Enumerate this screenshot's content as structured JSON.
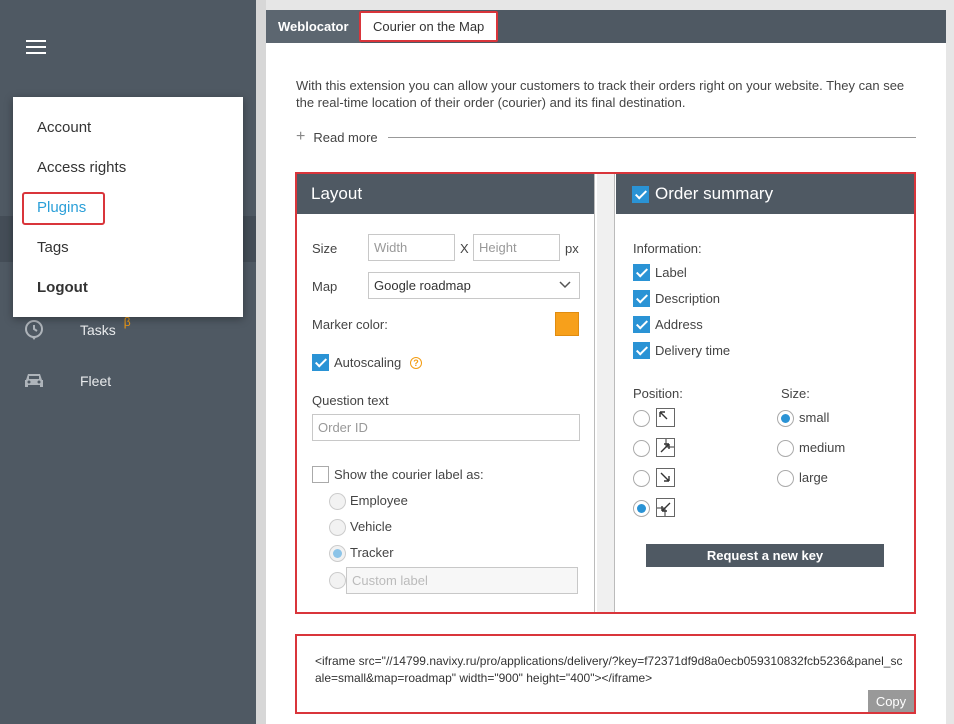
{
  "sidebar": {
    "menu_icon": "hamburger-icon",
    "items": [
      {
        "label": "Tasks",
        "icon": "location-pin-icon",
        "badge": "β"
      },
      {
        "label": "Fleet",
        "icon": "car-icon"
      }
    ]
  },
  "user_menu": {
    "items": [
      {
        "label": "Account"
      },
      {
        "label": "Access rights"
      },
      {
        "label": "Plugins"
      },
      {
        "label": "Tags"
      },
      {
        "label": "Logout"
      }
    ]
  },
  "tabs": [
    {
      "label": "Weblocator"
    },
    {
      "label": "Courier on the Map"
    }
  ],
  "intro": {
    "text": "With this extension you can allow your customers to track their orders right on your website. They can see the real-time location of their order (courier) and its final destination.",
    "read_more": "Read more"
  },
  "layout": {
    "title": "Layout",
    "size_label": "Size",
    "width_placeholder": "Width",
    "x_sep": "X",
    "height_placeholder": "Height",
    "unit": "px",
    "map_label": "Map",
    "map_value": "Google roadmap",
    "marker_label": "Marker color:",
    "marker_color": "#f7a01b",
    "autoscaling_label": "Autoscaling",
    "autoscaling_checked": true,
    "help_glyph": "?",
    "question_label": "Question text",
    "question_placeholder": "Order ID",
    "courier_label": "Show the courier label as:",
    "courier_checked": false,
    "courier_options": [
      {
        "label": "Employee"
      },
      {
        "label": "Vehicle"
      },
      {
        "label": "Tracker"
      }
    ],
    "custom_placeholder": "Custom label"
  },
  "order": {
    "title": "Order summary",
    "information_label": "Information:",
    "info_items": [
      {
        "label": "Label"
      },
      {
        "label": "Description"
      },
      {
        "label": "Address"
      },
      {
        "label": "Delivery time"
      }
    ],
    "position_label": "Position:",
    "size_label": "Size:",
    "sizes": [
      {
        "label": "small"
      },
      {
        "label": "medium"
      },
      {
        "label": "large"
      }
    ],
    "request_key": "Request a new key"
  },
  "code": {
    "snippet": "<iframe src=\"//14799.navixy.ru/pro/applications/delivery/?key=f72371df9d8a0ecb059310832fcb5236&panel_scale=small&map=roadmap\" width=\"900\" height=\"400\"></iframe>",
    "copy_label": "Copy"
  }
}
